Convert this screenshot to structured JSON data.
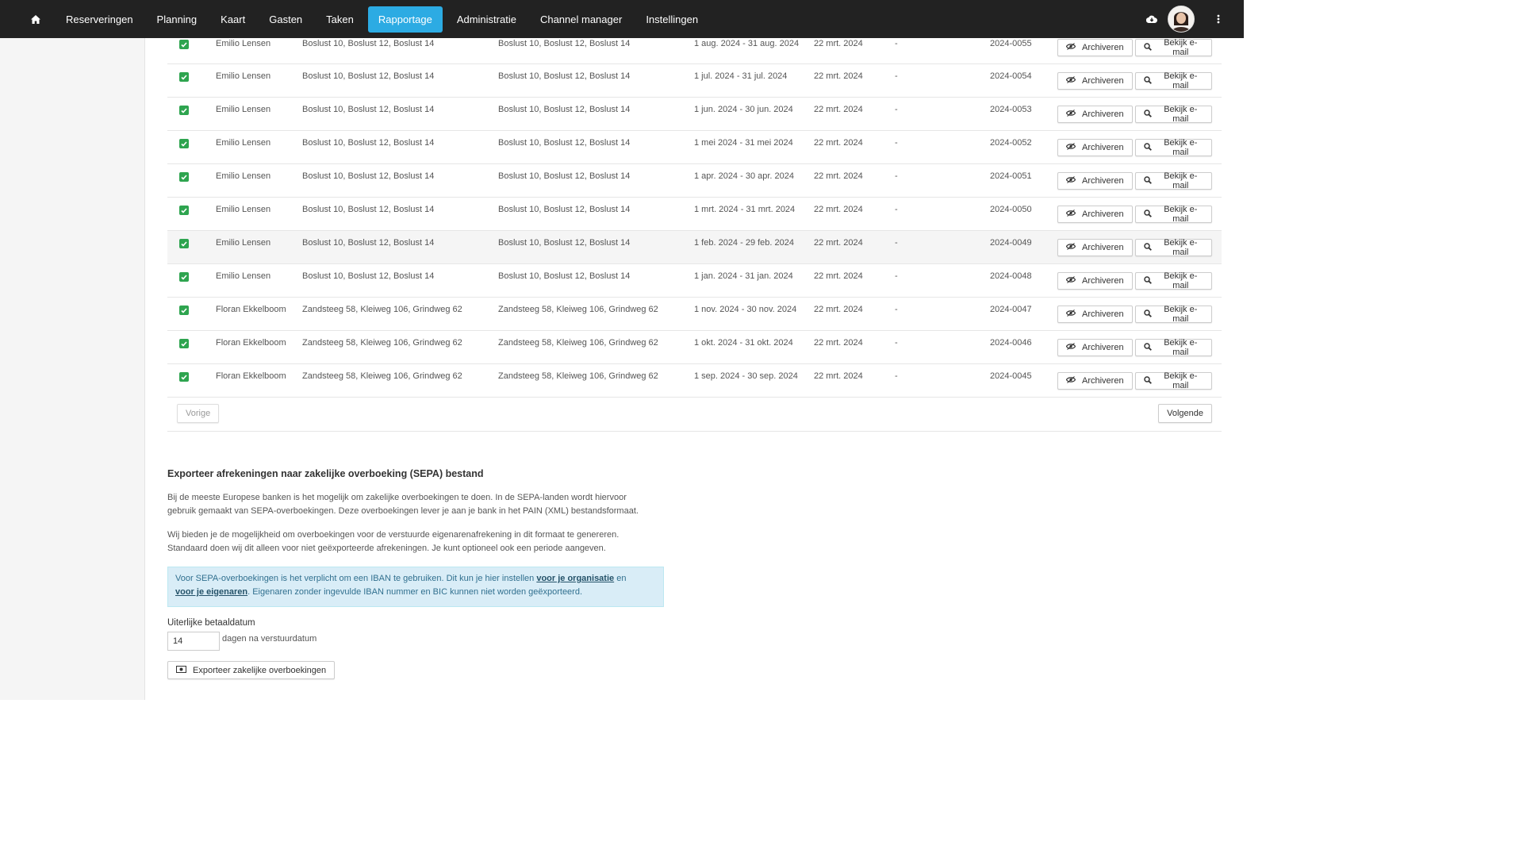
{
  "nav": {
    "items": [
      "Reserveringen",
      "Planning",
      "Kaart",
      "Gasten",
      "Taken",
      "Rapportage",
      "Administratie",
      "Channel manager",
      "Instellingen"
    ],
    "active": "Rapportage",
    "accent": "#2cabe3"
  },
  "table": {
    "rows": [
      {
        "owner": "Emilio Lensen",
        "accommodations": "Boslust 10, Boslust 12, Boslust 14",
        "accommodations2": "Boslust 10, Boslust 12, Boslust 14",
        "period": "1 aug. 2024 - 31 aug. 2024",
        "sent": "22 mrt. 2024",
        "paid": "-",
        "number": "2024-0055"
      },
      {
        "owner": "Emilio Lensen",
        "accommodations": "Boslust 10, Boslust 12, Boslust 14",
        "accommodations2": "Boslust 10, Boslust 12, Boslust 14",
        "period": "1 jul. 2024 - 31 jul. 2024",
        "sent": "22 mrt. 2024",
        "paid": "-",
        "number": "2024-0054"
      },
      {
        "owner": "Emilio Lensen",
        "accommodations": "Boslust 10, Boslust 12, Boslust 14",
        "accommodations2": "Boslust 10, Boslust 12, Boslust 14",
        "period": "1 jun. 2024 - 30 jun. 2024",
        "sent": "22 mrt. 2024",
        "paid": "-",
        "number": "2024-0053"
      },
      {
        "owner": "Emilio Lensen",
        "accommodations": "Boslust 10, Boslust 12, Boslust 14",
        "accommodations2": "Boslust 10, Boslust 12, Boslust 14",
        "period": "1 mei 2024 - 31 mei 2024",
        "sent": "22 mrt. 2024",
        "paid": "-",
        "number": "2024-0052"
      },
      {
        "owner": "Emilio Lensen",
        "accommodations": "Boslust 10, Boslust 12, Boslust 14",
        "accommodations2": "Boslust 10, Boslust 12, Boslust 14",
        "period": "1 apr. 2024 - 30 apr. 2024",
        "sent": "22 mrt. 2024",
        "paid": "-",
        "number": "2024-0051"
      },
      {
        "owner": "Emilio Lensen",
        "accommodations": "Boslust 10, Boslust 12, Boslust 14",
        "accommodations2": "Boslust 10, Boslust 12, Boslust 14",
        "period": "1 mrt. 2024 - 31 mrt. 2024",
        "sent": "22 mrt. 2024",
        "paid": "-",
        "number": "2024-0050"
      },
      {
        "owner": "Emilio Lensen",
        "accommodations": "Boslust 10, Boslust 12, Boslust 14",
        "accommodations2": "Boslust 10, Boslust 12, Boslust 14",
        "period": "1 feb. 2024 - 29 feb. 2024",
        "sent": "22 mrt. 2024",
        "paid": "-",
        "number": "2024-0049"
      },
      {
        "owner": "Emilio Lensen",
        "accommodations": "Boslust 10, Boslust 12, Boslust 14",
        "accommodations2": "Boslust 10, Boslust 12, Boslust 14",
        "period": "1 jan. 2024 - 31 jan. 2024",
        "sent": "22 mrt. 2024",
        "paid": "-",
        "number": "2024-0048"
      },
      {
        "owner": "Floran Ekkelboom",
        "accommodations": "Zandsteeg 58, Kleiweg 106, Grindweg 62",
        "accommodations2": "Zandsteeg 58, Kleiweg 106, Grindweg 62",
        "period": "1 nov. 2024 - 30 nov. 2024",
        "sent": "22 mrt. 2024",
        "paid": "-",
        "number": "2024-0047"
      },
      {
        "owner": "Floran Ekkelboom",
        "accommodations": "Zandsteeg 58, Kleiweg 106, Grindweg 62",
        "accommodations2": "Zandsteeg 58, Kleiweg 106, Grindweg 62",
        "period": "1 okt. 2024 - 31 okt. 2024",
        "sent": "22 mrt. 2024",
        "paid": "-",
        "number": "2024-0046"
      },
      {
        "owner": "Floran Ekkelboom",
        "accommodations": "Zandsteeg 58, Kleiweg 106, Grindweg 62",
        "accommodations2": "Zandsteeg 58, Kleiweg 106, Grindweg 62",
        "period": "1 sep. 2024 - 30 sep. 2024",
        "sent": "22 mrt. 2024",
        "paid": "-",
        "number": "2024-0045"
      }
    ],
    "archive_label": "Archiveren",
    "view_email_label": "Bekijk e-mail",
    "checkbox_color": "#2ea44f"
  },
  "pager": {
    "prev": "Vorige",
    "next": "Volgende"
  },
  "sepa": {
    "title": "Exporteer afrekeningen naar zakelijke overboeking (SEPA) bestand",
    "p1_line1": "Bij de meeste Europese banken is het mogelijk om zakelijke overboekingen te doen. In de SEPA-landen wordt hiervoor",
    "p1_line2": "gebruik gemaakt van SEPA-overboekingen. Deze overboekingen lever je aan je bank in het PAIN (XML) bestandsformaat.",
    "p2_line1": "Wij bieden je de mogelijkheid om overboekingen voor de verstuurde eigenarenafrekening in dit formaat te genereren.",
    "p2_line2": "Standaard doen wij dit alleen voor niet geëxporteerde afrekeningen. Je kunt optioneel ook een periode aangeven.",
    "alert_text1": "Voor SEPA-overboekingen is het verplicht om een IBAN te gebruiken. Dit kun je hier instellen ",
    "alert_link1": "voor je organisatie",
    "alert_text2": " en",
    "alert_link2": "voor je eigenaren",
    "alert_text3": ". Eigenaren zonder ingevulde IBAN nummer en BIC kunnen niet worden geëxporteerd.",
    "due_label": "Uiterlijke betaaldatum",
    "due_value": "14",
    "due_after": "dagen na verstuurdatum",
    "export_button": "Exporteer zakelijke overboekingen"
  }
}
